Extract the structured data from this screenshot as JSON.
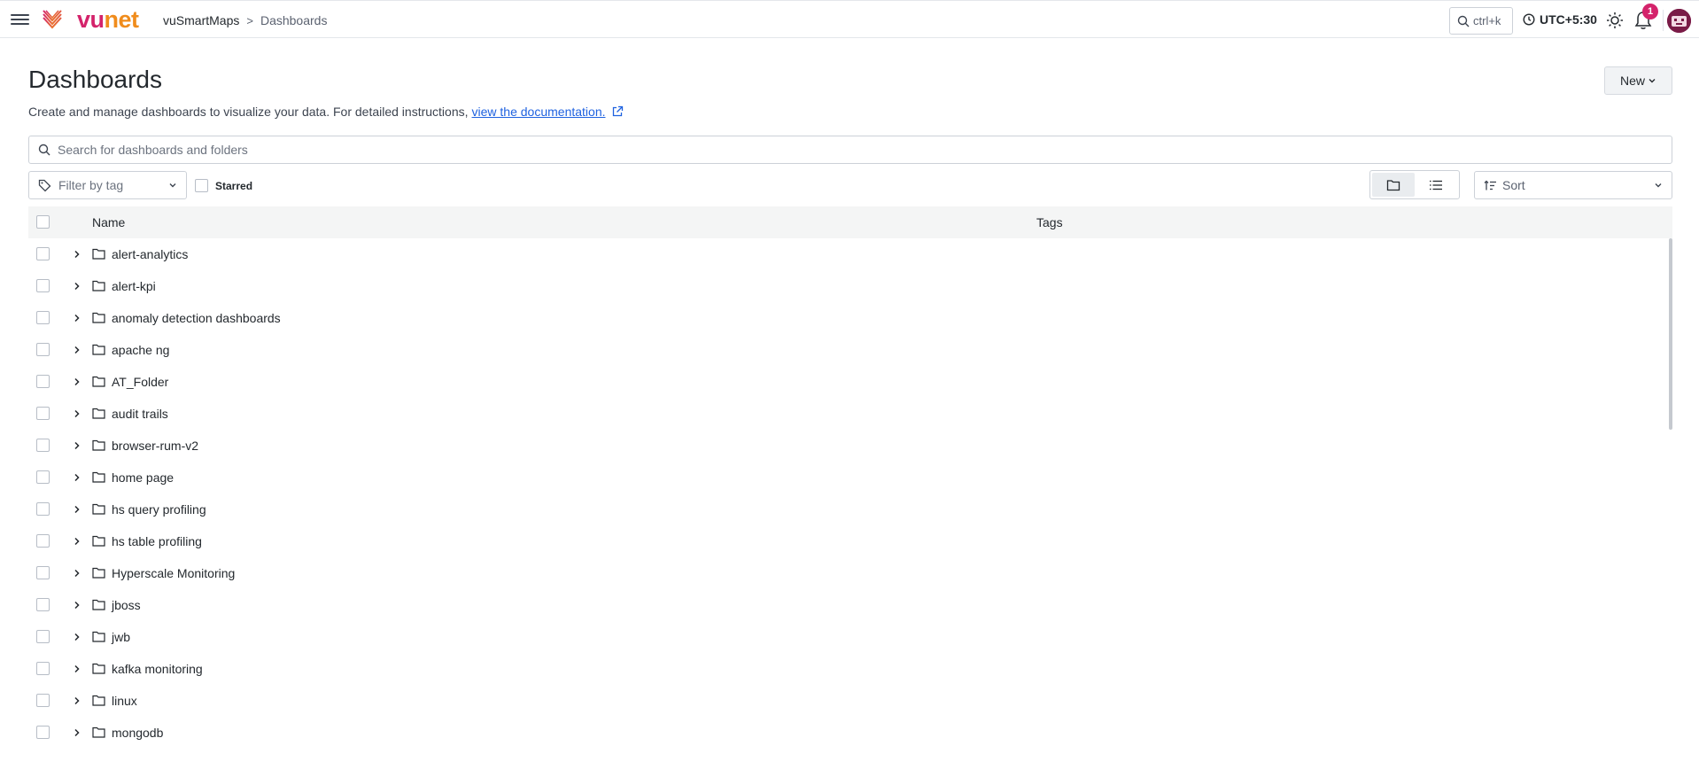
{
  "app": {
    "logo_vu": "vu",
    "logo_net": "net",
    "brand_colors": {
      "primary": "#d4236b",
      "secondary": "#f08c1c",
      "link": "#1f62e0"
    }
  },
  "breadcrumb": {
    "root": "vuSmartMaps",
    "separator": ">",
    "current": "Dashboards"
  },
  "topbar": {
    "search_shortcut": "ctrl+k",
    "timezone": "UTC+5:30",
    "notification_count": "1",
    "icons": [
      "menu-icon",
      "search-icon",
      "clock-icon",
      "sun-icon",
      "bell-icon",
      "avatar"
    ]
  },
  "page": {
    "title": "Dashboards",
    "description": "Create and manage dashboards to visualize your data. For detailed instructions,",
    "doc_link": "view the documentation.",
    "new_button": "New"
  },
  "search": {
    "placeholder": "Search for dashboards and folders",
    "value": ""
  },
  "filters": {
    "tag_placeholder": "Filter by tag",
    "starred_label": "Starred",
    "starred_checked": false,
    "view_mode": "folder",
    "sort_placeholder": "Sort"
  },
  "table": {
    "columns": {
      "name": "Name",
      "tags": "Tags"
    },
    "rows": [
      "alert-analytics",
      "alert-kpi",
      "anomaly detection dashboards",
      "apache ng",
      "AT_Folder",
      "audit trails",
      "browser-rum-v2",
      "home page",
      "hs query profiling",
      "hs table profiling",
      "Hyperscale Monitoring",
      "jboss",
      "jwb",
      "kafka monitoring",
      "linux",
      "mongodb"
    ]
  }
}
